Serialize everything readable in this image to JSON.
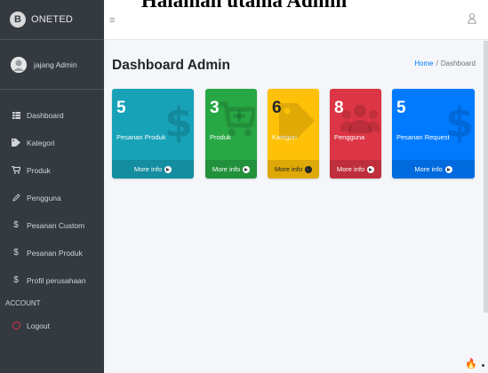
{
  "caption": "Halaman utama Admin",
  "sidebar": {
    "brand_logo": "B",
    "brand": "ONETED",
    "user": "jajang Admin",
    "items": [
      {
        "label": "Dashboard",
        "icon": "table-icon"
      },
      {
        "label": "Kategori",
        "icon": "tags-icon"
      },
      {
        "label": "Produk",
        "icon": "cart-icon"
      },
      {
        "label": "Pengguna",
        "icon": "edit-icon"
      },
      {
        "label": "Pesanan Custom",
        "icon": "dollar-icon"
      },
      {
        "label": "Pesanan Produk",
        "icon": "dollar-icon"
      },
      {
        "label": "Profil perusahaan",
        "icon": "dollar-icon"
      }
    ],
    "section_header": "ACCOUNT",
    "logout": "Logout"
  },
  "topbar": {
    "menu_icon": "hamburger-icon",
    "user_icon": "user-icon"
  },
  "main": {
    "title": "Dashboard Admin",
    "breadcrumb": {
      "home": "Home",
      "separator": "/",
      "current": "Dashboard"
    }
  },
  "cards": [
    {
      "value": "5",
      "label": "Pesanan Produk",
      "footer": "More info",
      "color": "#17a2b8",
      "icon": "dollar-icon"
    },
    {
      "value": "3",
      "label": "Produk",
      "footer": "More info",
      "color": "#28a745",
      "icon": "cart-plus-icon"
    },
    {
      "value": "6",
      "label": "Kategori",
      "footer": "More info",
      "color": "#ffc107",
      "icon": "tag-icon"
    },
    {
      "value": "8",
      "label": "Pengguna",
      "footer": "More info",
      "color": "#dc3545",
      "icon": "users-icon"
    },
    {
      "value": "5",
      "label": "Pesanan Request",
      "footer": "More info",
      "color": "#007bff",
      "icon": "dollar-icon"
    }
  ],
  "colors": {
    "sidebar": "#343a40",
    "content": "#f4f6f9",
    "link": "#007bff"
  }
}
